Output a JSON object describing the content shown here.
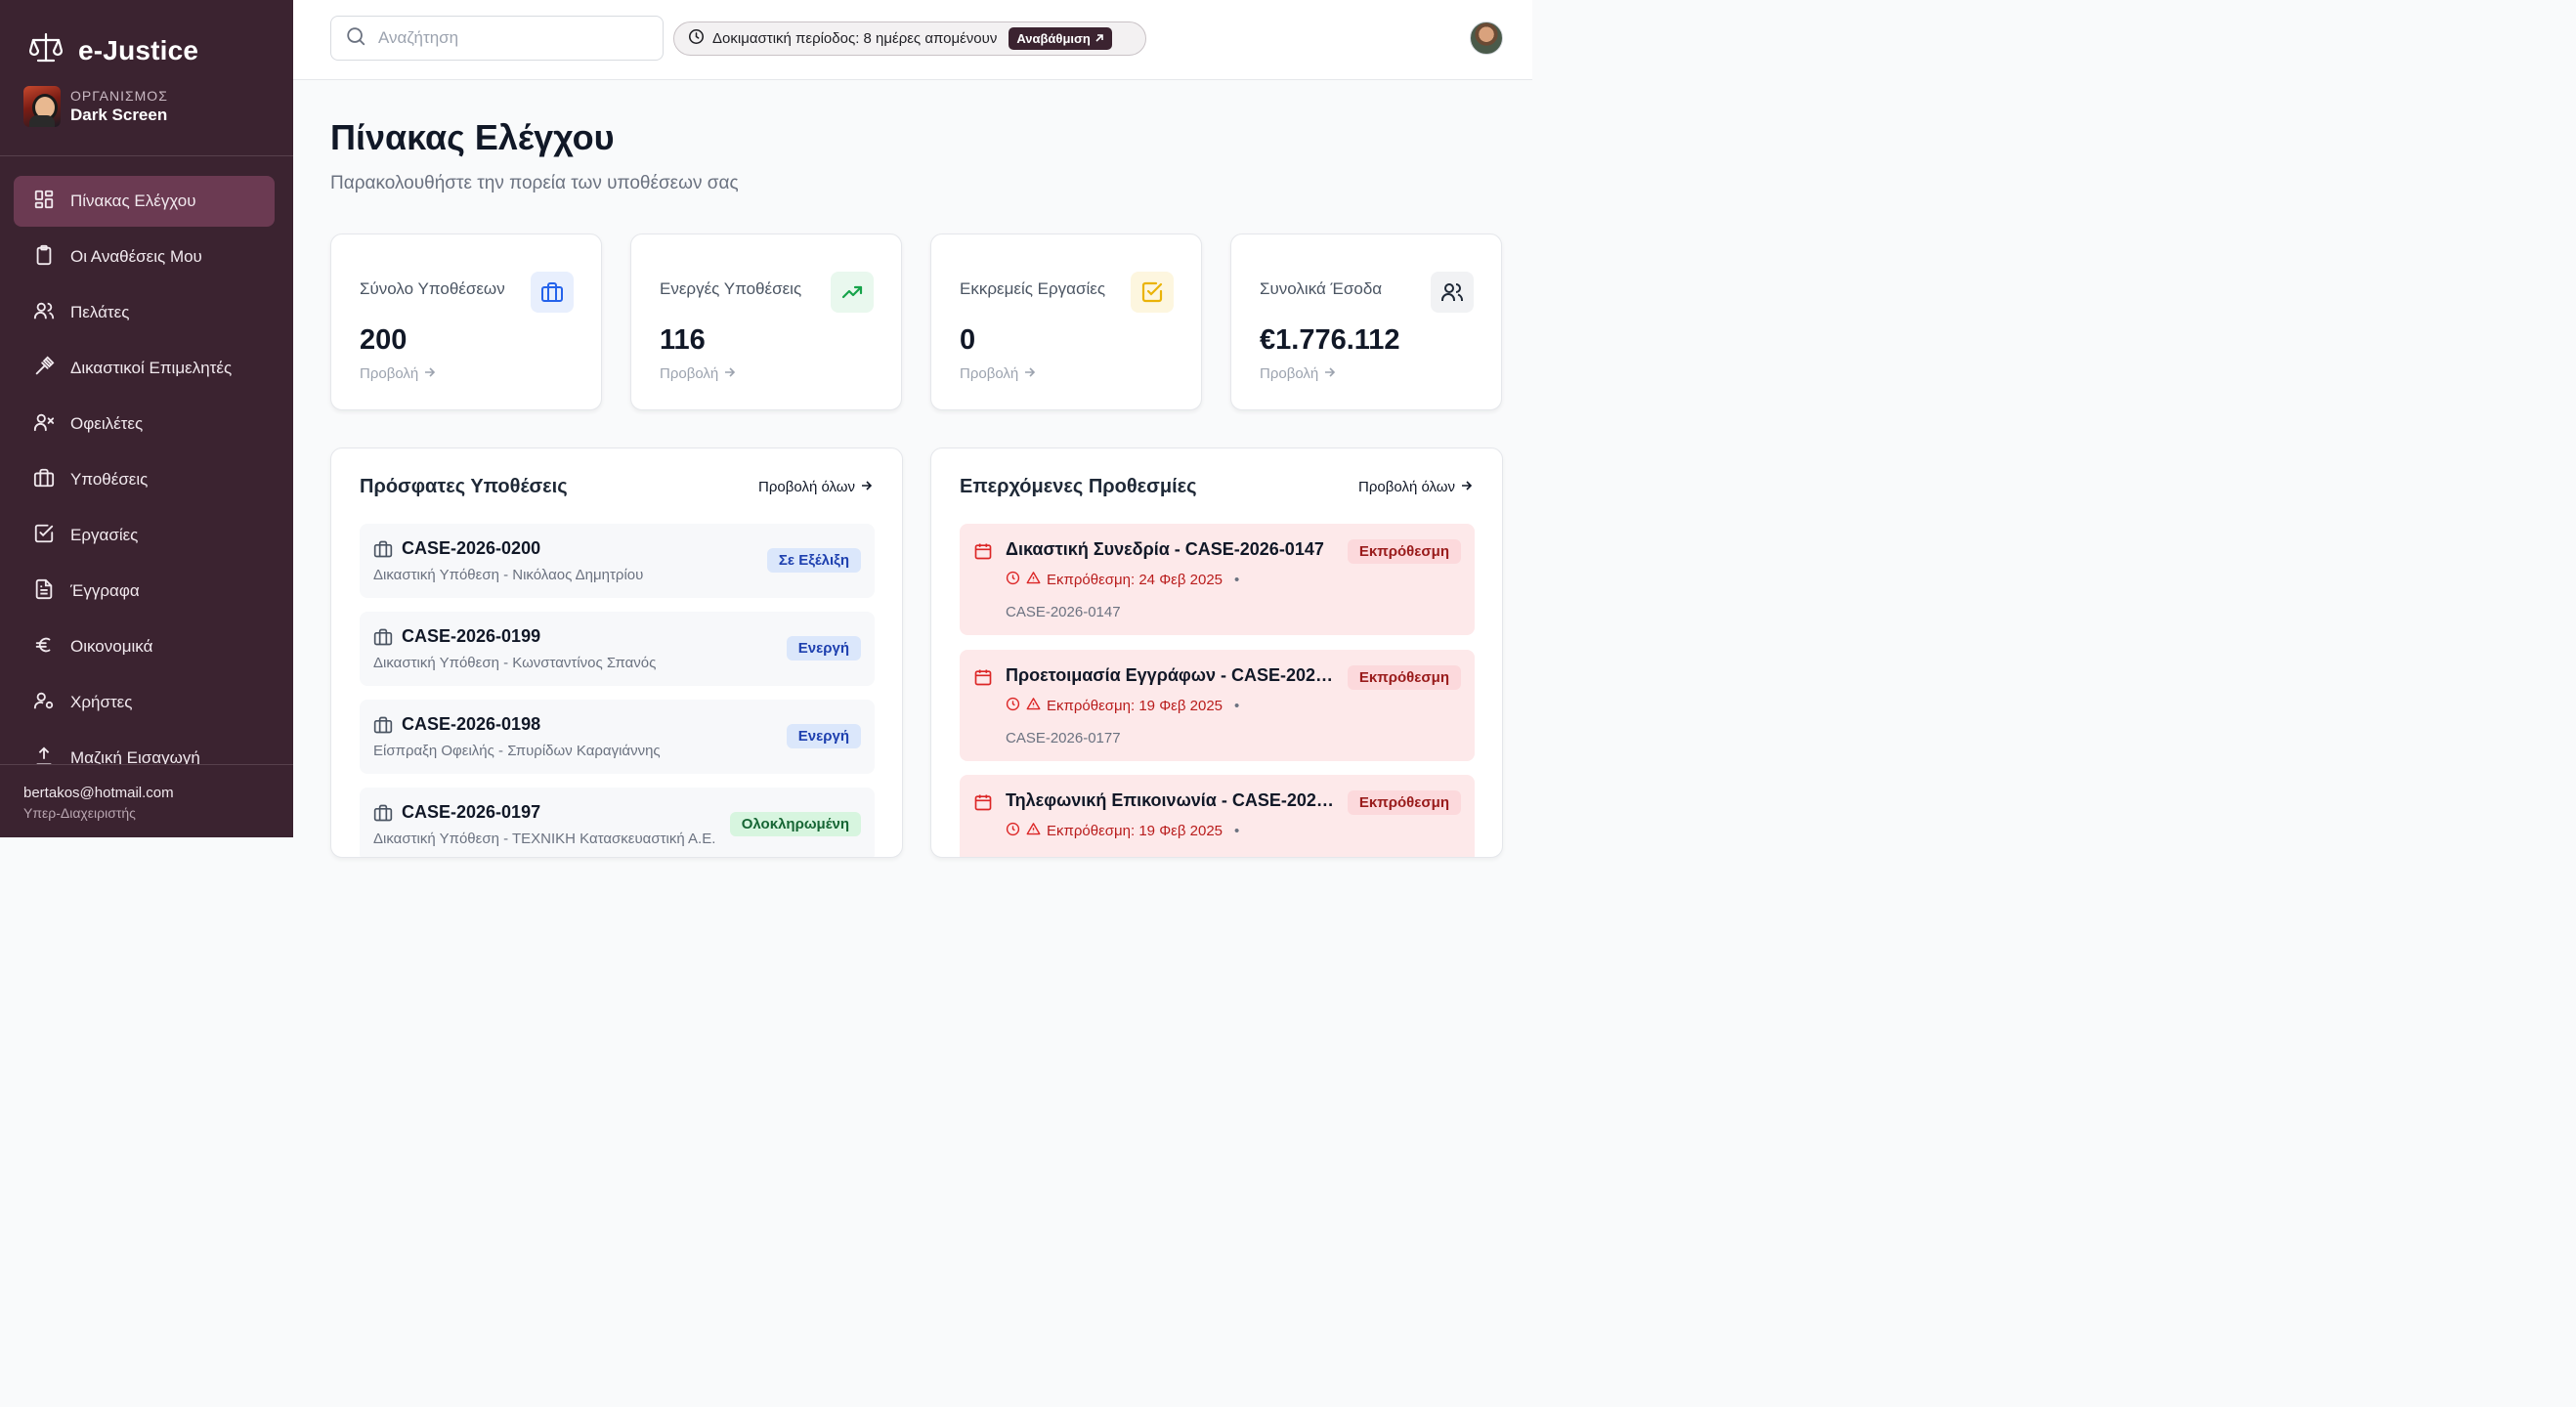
{
  "app": {
    "name": "e-Justice"
  },
  "organization": {
    "label": "ΟΡΓΑΝΙΣΜΟΣ",
    "name": "Dark Screen"
  },
  "sidebar": {
    "items": [
      {
        "label": "Πίνακας Ελέγχου",
        "icon": "dashboard-icon",
        "active": true
      },
      {
        "label": "Οι Αναθέσεις Μου",
        "icon": "clipboard-icon"
      },
      {
        "label": "Πελάτες",
        "icon": "users-icon"
      },
      {
        "label": "Δικαστικοί Επιμελητές",
        "icon": "gavel-icon"
      },
      {
        "label": "Οφειλέτες",
        "icon": "user-x-icon"
      },
      {
        "label": "Υποθέσεις",
        "icon": "briefcase-icon"
      },
      {
        "label": "Εργασίες",
        "icon": "checkbox-icon"
      },
      {
        "label": "Έγγραφα",
        "icon": "document-icon"
      },
      {
        "label": "Οικονομικά",
        "icon": "euro-icon"
      },
      {
        "label": "Χρήστες",
        "icon": "user-gear-icon"
      },
      {
        "label": "Μαζική Εισαγωγή",
        "icon": "upload-icon"
      }
    ],
    "footer": {
      "email": "bertakos@hotmail.com",
      "role": "Υπερ-Διαχειριστής"
    }
  },
  "header": {
    "search_placeholder": "Αναζήτηση",
    "trial_text": "Δοκιμαστική περίοδος: 8 ημέρες απομένουν",
    "upgrade_label": "Αναβάθμιση"
  },
  "page": {
    "title": "Πίνακας Ελέγχου",
    "subtitle": "Παρακολουθήστε την πορεία των υποθέσεων σας"
  },
  "stats": [
    {
      "label": "Σύνολο Υποθέσεων",
      "value": "200",
      "link": "Προβολή",
      "icon": "briefcase-icon",
      "color": "#2563eb",
      "bg": "#e8effd"
    },
    {
      "label": "Ενεργές Υποθέσεις",
      "value": "116",
      "link": "Προβολή",
      "icon": "trending-up-icon",
      "color": "#16a34a",
      "bg": "#e9f8ee"
    },
    {
      "label": "Εκκρεμείς Εργασίες",
      "value": "0",
      "link": "Προβολή",
      "icon": "checkbox-icon",
      "color": "#eab308",
      "bg": "#fdf6df"
    },
    {
      "label": "Συνολικά Έσοδα",
      "value": "€1.776.112",
      "link": "Προβολή",
      "icon": "users-icon",
      "color": "#1f2937",
      "bg": "#f1f2f4"
    }
  ],
  "recent_cases": {
    "title": "Πρόσφατες Υποθέσεις",
    "view_all": "Προβολή όλων",
    "items": [
      {
        "id": "CASE-2026-0200",
        "desc": "Δικαστική Υπόθεση - Νικόλαος Δημητρίου",
        "status": "Σε Εξέλιξη",
        "status_color": "blue"
      },
      {
        "id": "CASE-2026-0199",
        "desc": "Δικαστική Υπόθεση - Κωνσταντίνος Σπανός",
        "status": "Ενεργή",
        "status_color": "blue"
      },
      {
        "id": "CASE-2026-0198",
        "desc": "Είσπραξη Οφειλής - Σπυρίδων Καραγιάννης",
        "status": "Ενεργή",
        "status_color": "blue"
      },
      {
        "id": "CASE-2026-0197",
        "desc": "Δικαστική Υπόθεση - ΤΕΧΝΙΚΗ Κατασκευαστική Α.Ε.",
        "status": "Ολοκληρωμένη",
        "status_color": "green"
      }
    ]
  },
  "deadlines": {
    "title": "Επερχόμενες Προθεσμίες",
    "view_all": "Προβολή όλων",
    "items": [
      {
        "title": "Δικαστική Συνεδρία - CASE-2026-0147",
        "due": "Εκπρόθεσμη: 24 Φεβ 2025",
        "case": "CASE-2026-0147",
        "status": "Εκπρόθεσμη"
      },
      {
        "title": "Προετοιμασία Εγγράφων - CASE-2026-...",
        "due": "Εκπρόθεσμη: 19 Φεβ 2025",
        "case": "CASE-2026-0177",
        "status": "Εκπρόθεσμη"
      },
      {
        "title": "Τηλεφωνική Επικοινωνία - CASE-2026-...",
        "due": "Εκπρόθεσμη: 19 Φεβ 2025",
        "case": "",
        "status": "Εκπρόθεσμη"
      }
    ]
  },
  "colors": {
    "sidebar_bg": "#3b2330",
    "sidebar_active": "#6b3a52",
    "overdue_bg": "#fde9ea",
    "overdue_text": "#b91c1c"
  }
}
